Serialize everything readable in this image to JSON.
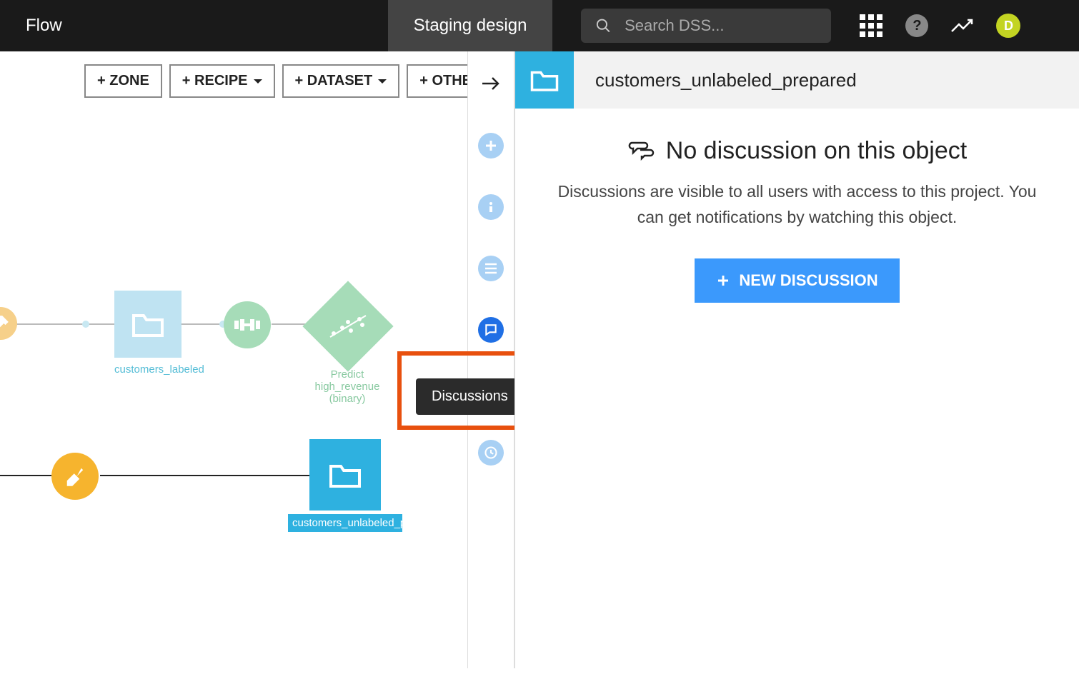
{
  "topbar": {
    "flow_tab": "Flow",
    "staging_tab": "Staging design",
    "search_placeholder": "Search DSS...",
    "avatar_initial": "D"
  },
  "toolbar": {
    "zone": "+ ZONE",
    "recipe": "+ RECIPE",
    "dataset": "+ DATASET",
    "other": "+ OTHER"
  },
  "flow": {
    "customers_labeled": "customers_labeled",
    "predict_model": "Predict high_revenue (binary)",
    "customers_unlabeled_prepared": "customers_unlabeled_prepared"
  },
  "rail": {
    "discussions_tooltip": "Discussions"
  },
  "panel": {
    "title": "customers_unlabeled_prepared",
    "heading": "No discussion on this object",
    "body": "Discussions are visible to all users with access to this project. You can get notifications by watching this object.",
    "new_button": "NEW DISCUSSION"
  }
}
